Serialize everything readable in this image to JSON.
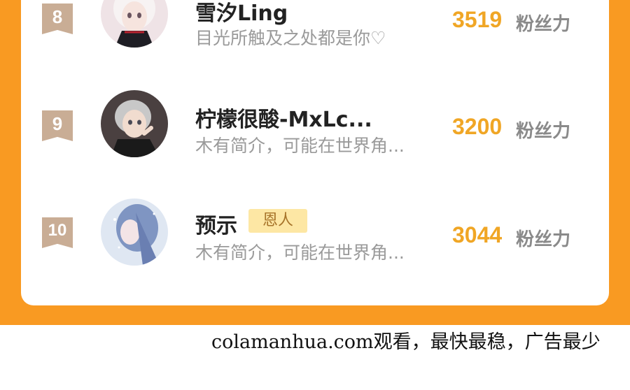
{
  "ranking": {
    "score_unit": "粉丝力",
    "rows": [
      {
        "rank": "8",
        "name": "雪汐Ling",
        "bio": "目光所触及之处都是你♡",
        "score": "3519",
        "tag": ""
      },
      {
        "rank": "9",
        "name": "柠檬很酸-MxLc...",
        "bio": "木有简介，可能在世界角...",
        "score": "3200",
        "tag": ""
      },
      {
        "rank": "10",
        "name": "预示",
        "bio": "木有简介，可能在世界角...",
        "score": "3044",
        "tag": "恩人"
      }
    ]
  },
  "footer": {
    "text": "colamanhua.com观看，最快最稳，广告最少"
  },
  "colors": {
    "panel_orange": "#f99a22",
    "score_orange": "#f0a625",
    "badge_tan": "#c9ad95",
    "tag_bg": "#fde7a4"
  }
}
